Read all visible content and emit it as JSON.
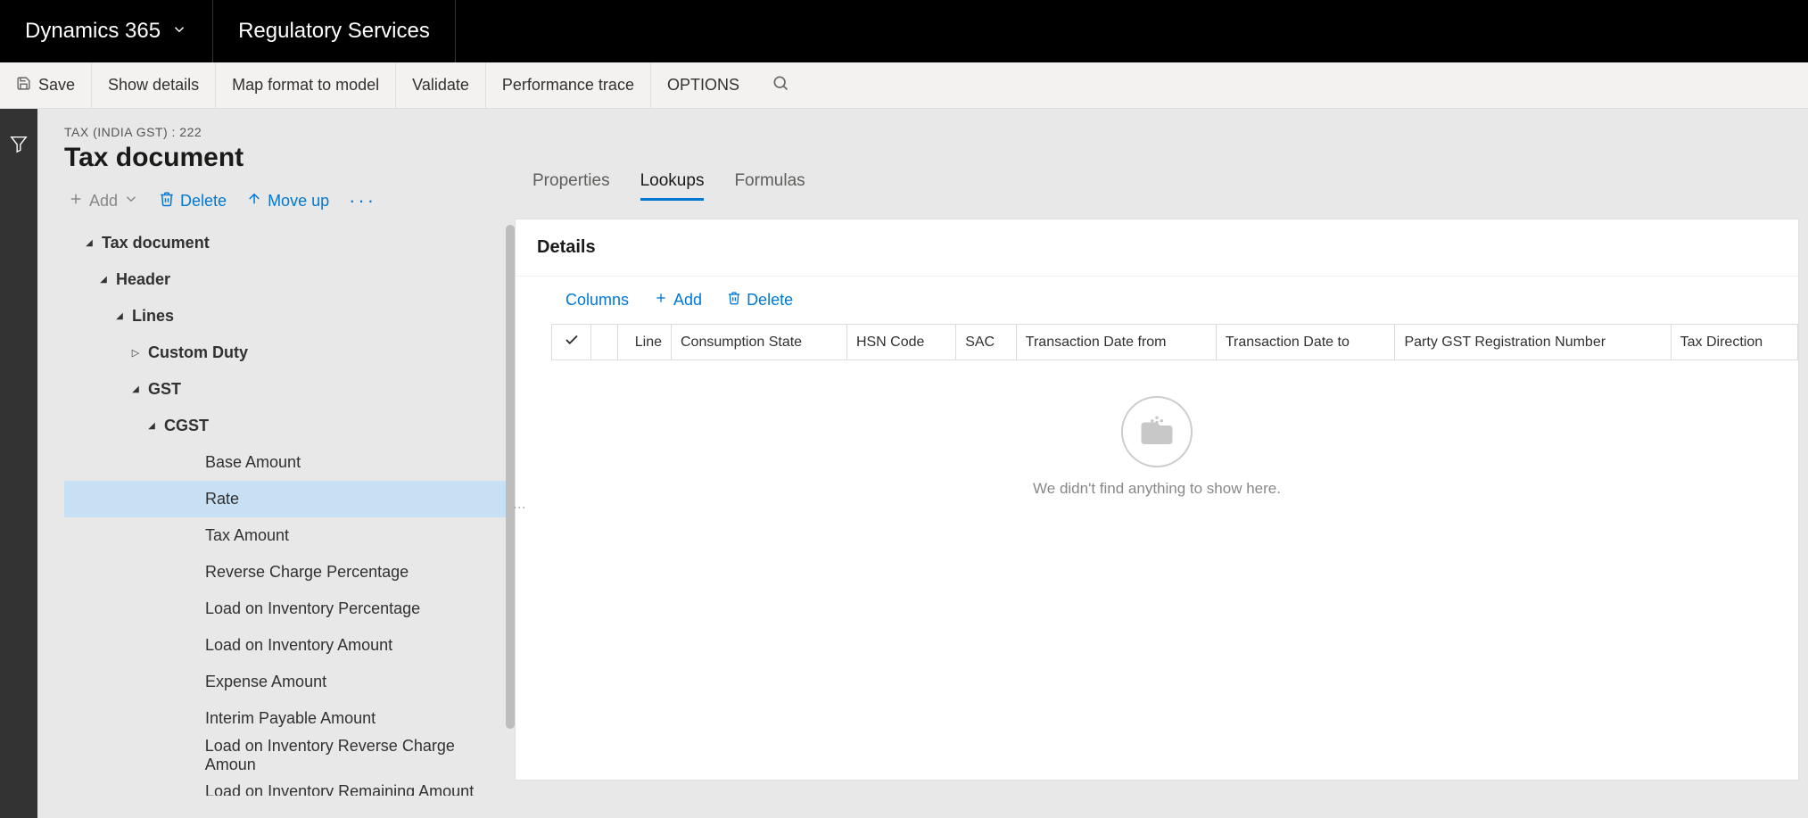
{
  "topnav": {
    "brand": "Dynamics 365",
    "app": "Regulatory Services"
  },
  "toolbar": {
    "save": "Save",
    "show_details": "Show details",
    "map_format": "Map format to model",
    "validate": "Validate",
    "perf_trace": "Performance trace",
    "options": "OPTIONS"
  },
  "page": {
    "crumb": "TAX (INDIA GST) : 222",
    "title": "Tax document"
  },
  "tree_toolbar": {
    "add": "Add",
    "delete": "Delete",
    "moveup": "Move up"
  },
  "tree": [
    {
      "level": 0,
      "bold": true,
      "caret": "expanded",
      "label": "Tax document",
      "name": "tax-document"
    },
    {
      "level": 1,
      "bold": true,
      "caret": "expanded",
      "label": "Header",
      "name": "header"
    },
    {
      "level": 2,
      "bold": true,
      "caret": "expanded",
      "label": "Lines",
      "name": "lines"
    },
    {
      "level": 3,
      "bold": true,
      "caret": "collapsed",
      "label": "Custom Duty",
      "name": "custom-duty"
    },
    {
      "level": 3,
      "bold": true,
      "caret": "expanded",
      "label": "GST",
      "name": "gst"
    },
    {
      "level": 4,
      "bold": true,
      "caret": "expanded",
      "label": "CGST",
      "name": "cgst"
    },
    {
      "level": 5,
      "bold": false,
      "caret": "none",
      "label": "Base Amount",
      "name": "base-amount"
    },
    {
      "level": 5,
      "bold": false,
      "caret": "none",
      "label": "Rate",
      "name": "rate",
      "selected": true
    },
    {
      "level": 5,
      "bold": false,
      "caret": "none",
      "label": "Tax Amount",
      "name": "tax-amount"
    },
    {
      "level": 5,
      "bold": false,
      "caret": "none",
      "label": "Reverse Charge Percentage",
      "name": "reverse-charge-pct"
    },
    {
      "level": 5,
      "bold": false,
      "caret": "none",
      "label": "Load on Inventory Percentage",
      "name": "load-inv-pct"
    },
    {
      "level": 5,
      "bold": false,
      "caret": "none",
      "label": "Load on Inventory Amount",
      "name": "load-inv-amt"
    },
    {
      "level": 5,
      "bold": false,
      "caret": "none",
      "label": "Expense Amount",
      "name": "expense-amount"
    },
    {
      "level": 5,
      "bold": false,
      "caret": "none",
      "label": "Interim Payable Amount",
      "name": "interim-payable"
    },
    {
      "level": 5,
      "bold": false,
      "caret": "none",
      "label": "Load on Inventory Reverse Charge Amoun",
      "name": "load-inv-rev-charge"
    },
    {
      "level": 5,
      "bold": false,
      "caret": "none",
      "label": "Load on Inventory Remaining Amount",
      "name": "load-inv-remaining"
    }
  ],
  "tabs": {
    "properties": "Properties",
    "lookups": "Lookups",
    "formulas": "Formulas"
  },
  "details": {
    "heading": "Details",
    "columns_btn": "Columns",
    "add_btn": "Add",
    "delete_btn": "Delete",
    "grid_headers": [
      "Line",
      "Consumption State",
      "HSN Code",
      "SAC",
      "Transaction Date from",
      "Transaction Date to",
      "Party GST Registration Number",
      "Tax Direction"
    ],
    "empty_msg": "We didn't find anything to show here."
  }
}
